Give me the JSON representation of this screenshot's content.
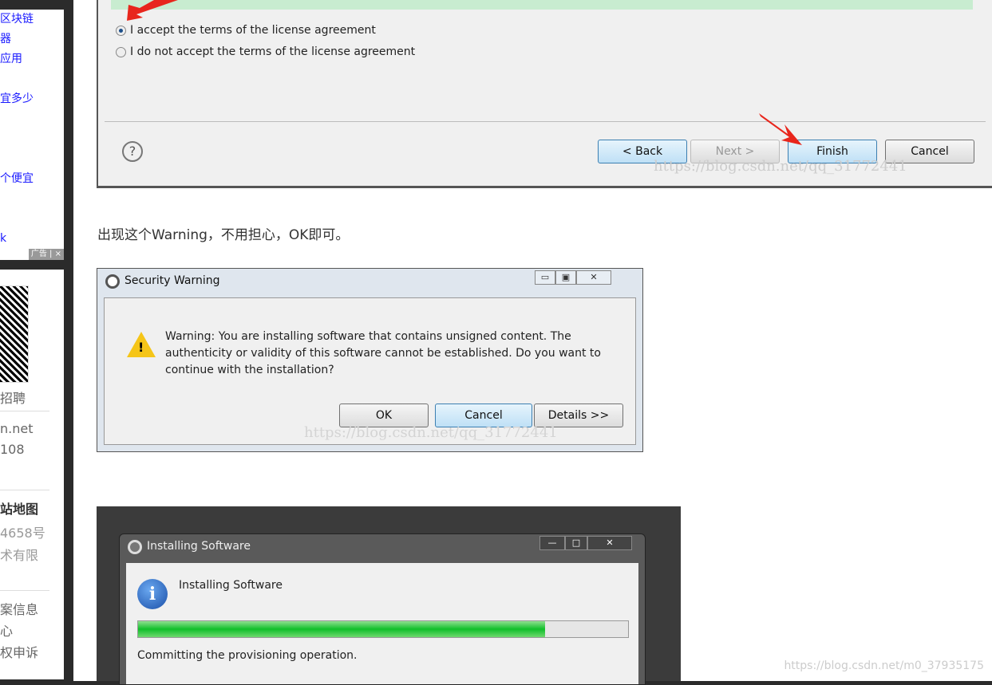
{
  "sidebar_ad": {
    "links": [
      "区块链",
      "器",
      "应用",
      "",
      "宜多少",
      "",
      "",
      "",
      "个便宜",
      "",
      "",
      "k"
    ],
    "ad_label": "广告",
    "close": "×"
  },
  "sidebar_info": {
    "recruit": "招聘",
    "email": "n.net",
    "phone": "108",
    "sitemap": "站地图",
    "icp": "4658号",
    "company": "术有限",
    "report1": "案信息",
    "report2": "心",
    "report3": "权申诉"
  },
  "license_dialog": {
    "accept": "I accept the terms of the license agreement",
    "decline": "I do not accept the terms of the license agreement",
    "accept_selected": true,
    "help": "?",
    "back": "< Back",
    "next": "Next >",
    "finish": "Finish",
    "cancel": "Cancel",
    "watermark": "https://blog.csdn.net/qq_31772441"
  },
  "paragraph": "出现这个Warning，不用担心，OK即可。",
  "security_warning": {
    "title": "Security Warning",
    "message": "Warning: You are installing software that contains unsigned content. The authenticity or validity of this software cannot be established. Do you want to continue with the installation?",
    "ok": "OK",
    "cancel": "Cancel",
    "details": "Details >>",
    "watermark": "https://blog.csdn.net/qq_31772441",
    "win_buttons": [
      "▭",
      "▣",
      "✕"
    ]
  },
  "installing": {
    "title": "Installing Software",
    "heading": "Installing Software",
    "status": "Committing the provisioning operation.",
    "progress_percent": 83,
    "win_buttons": [
      "—",
      "□",
      "✕"
    ]
  },
  "footer_watermark": "https://blog.csdn.net/m0_37935175"
}
